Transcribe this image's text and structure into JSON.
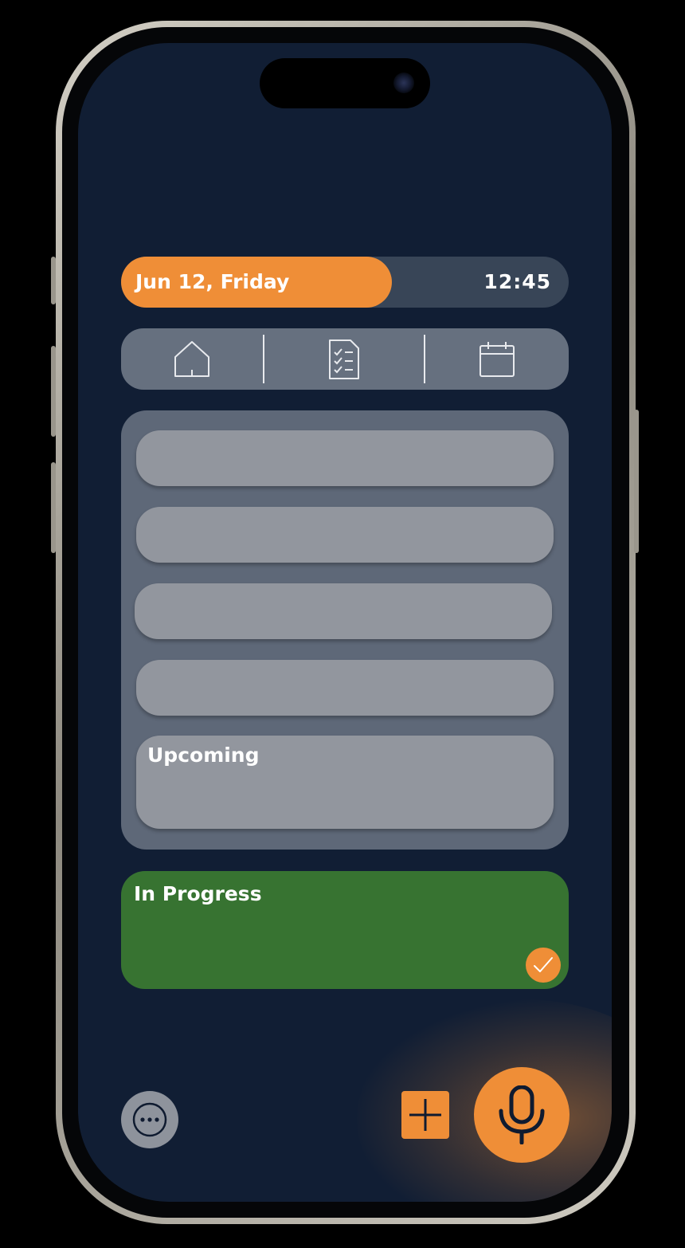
{
  "header": {
    "date": "Jun 12, Friday",
    "time": "12:45"
  },
  "nav": {
    "items": [
      {
        "icon": "home-icon"
      },
      {
        "icon": "checklist-icon"
      },
      {
        "icon": "calendar-icon"
      }
    ]
  },
  "tasks": {
    "upcoming_label": "Upcoming"
  },
  "in_progress": {
    "label": "In Progress",
    "color": "#377331"
  },
  "actions": {
    "more_icon": "more-icon",
    "add_icon": "plus-icon",
    "voice_icon": "microphone-icon"
  },
  "colors": {
    "accent": "#ef8e37",
    "background": "#111e34",
    "panel": "#5e6878",
    "row": "#92969e"
  }
}
